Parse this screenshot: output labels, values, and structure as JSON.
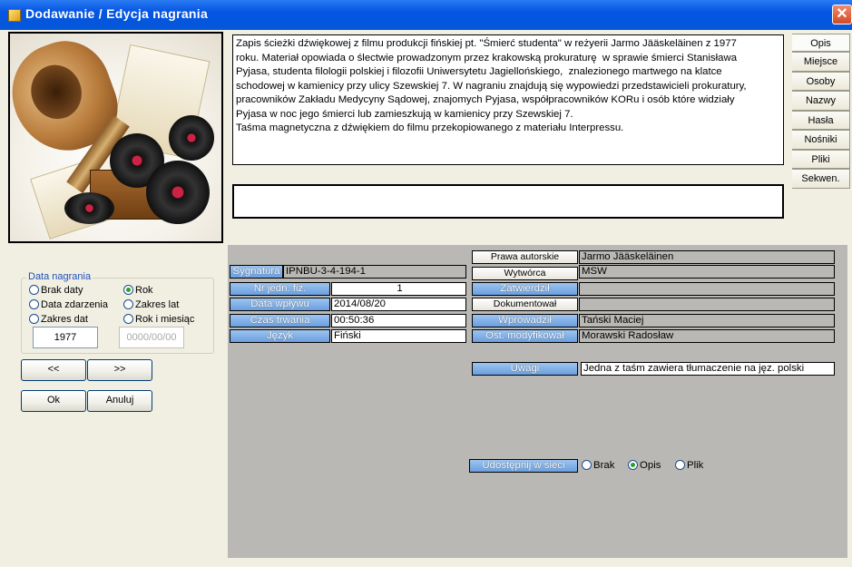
{
  "window": {
    "title": "Dodawanie / Edycja nagrania",
    "close_label": "✕"
  },
  "description": {
    "text": "Zapis ścieżki dźwiękowej z filmu produkcji fińskiej pt. \"Śmierć studenta\" w reżyerii Jarmo Jääskeläinen z 1977\nroku. Materiał opowiada o ślectwie prowadzonym przez krakowską prokuraturę  w sprawie śmierci Stanisława\nPyjasa, studenta filologii polskiej i filozofii Uniwersytetu Jagiellońskiego,  znalezionego martwego na klatce\nschodowej w kamienicy przy ulicy Szewskiej 7. W nagraniu znajdują się wypowiedzi przedstawicieli prokuratury,\npracowników Zakładu Medycyny Sądowej, znajomych Pyjasa, współpracowników KORu i osób które widziały\nPyjasa w noc jego śmierci lub zamieszkują w kamienicy przy Szewskiej 7.\nTaśma magnetyczna z dźwiękiem do filmu przekopiowanego z materiału Interpressu.",
    "secondary": ""
  },
  "tabs": [
    "Opis",
    "Miejsce",
    "Osoby",
    "Nazwy",
    "Hasła",
    "Nośniki",
    "Pliki",
    "Sekwen."
  ],
  "date_group": {
    "title": "Data nagrania",
    "options": [
      "Brak daty",
      "Rok",
      "Data zdarzenia",
      "Zakres lat",
      "Zakres dat",
      "Rok i miesiąc"
    ],
    "selected": "Rok",
    "year_value": "1977",
    "date_value": "0000/00/00"
  },
  "nav": {
    "prev": "<<",
    "next": ">>",
    "ok": "Ok",
    "cancel": "Anuluj"
  },
  "fields_left": {
    "sygnatura_label": "Sygnatura",
    "sygnatura_value": "IPNBU-3-4-194-1",
    "nr_label": "Nr jedn. fiz.",
    "nr_value": "1",
    "data_label": "Data wpływu",
    "data_value": "2014/08/20",
    "czas_label": "Czas trwania",
    "czas_value": "00:50:36",
    "jezyk_label": "Język",
    "jezyk_value": "Fiński"
  },
  "fields_right": {
    "prawa_label": "Prawa autorskie",
    "prawa_value": "Jarmo Jääskeläinen",
    "wytworca_label": "Wytwórca",
    "wytworca_value": "MSW",
    "zatwierdzil_label": "Zatwierdził",
    "zatwierdzil_value": "",
    "dokumentowal_label": "Dokumentował",
    "dokumentowal_value": "",
    "wprowadzil_label": "Wprowadził",
    "wprowadzil_value": "Tański Maciej",
    "ostmod_label": "Ost. modyfikował",
    "ostmod_value": "Morawski Radosław"
  },
  "uwagi": {
    "label": "Uwagi",
    "value": "Jedna z taśm zawiera tłumaczenie na jęz. polski"
  },
  "share": {
    "label": "Udostępnij w sieci",
    "options": [
      "Brak",
      "Opis",
      "Plik"
    ],
    "selected": "Opis"
  },
  "colors": {
    "titlebar": "#0554e3",
    "label_blue": "#6b9fe0",
    "panel_gray": "#b9b8b5"
  }
}
